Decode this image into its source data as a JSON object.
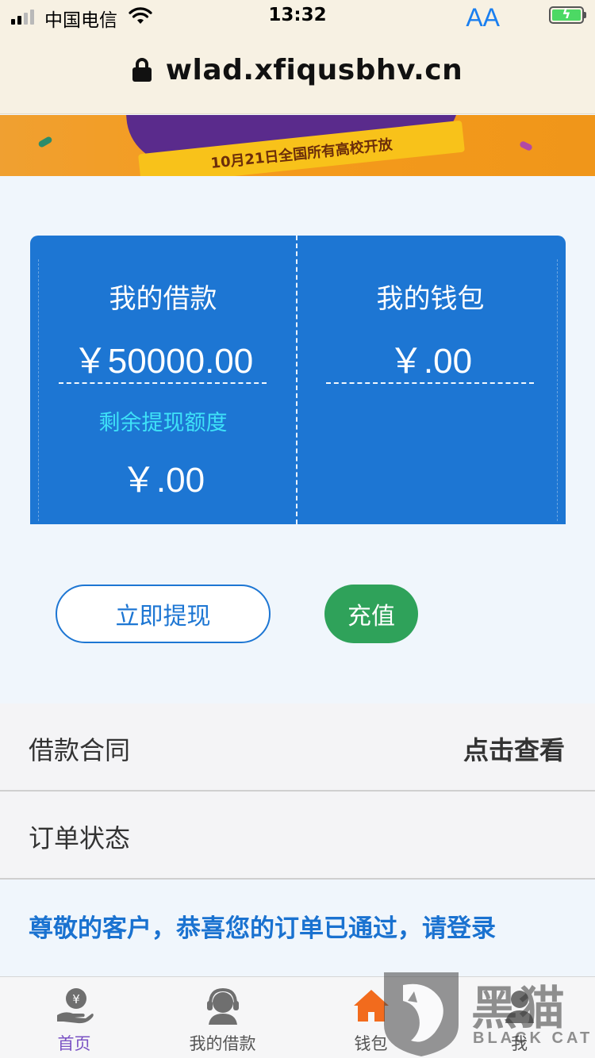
{
  "status_bar": {
    "carrier": "中国电信",
    "time": "13:32"
  },
  "browser": {
    "url": "wlad.xfiqusbhv.cn",
    "text_size_label": "AA"
  },
  "banner": {
    "text": "10月21日全国所有高校开放"
  },
  "card": {
    "loan": {
      "title": "我的借款",
      "amount": "￥50000.00",
      "sub_label": "剩余提现额度",
      "sub_amount": "￥.00"
    },
    "wallet": {
      "title": "我的钱包",
      "amount": "￥.00"
    }
  },
  "actions": {
    "withdraw_label": "立即提现",
    "recharge_label": "充值"
  },
  "list": {
    "contract": {
      "label": "借款合同",
      "action": "点击查看"
    },
    "order_status": {
      "label": "订单状态"
    }
  },
  "notice": "尊敬的客户，恭喜您的订单已通过，请登录",
  "tabs": [
    {
      "label": "首页",
      "icon": "hand-yen-icon",
      "active": true
    },
    {
      "label": "我的借款",
      "icon": "customer-service-icon",
      "active": false
    },
    {
      "label": "钱包",
      "icon": "home-icon",
      "active": false
    },
    {
      "label": "我",
      "icon": "person-icon",
      "active": false
    }
  ],
  "watermark": {
    "brand": "黑猫",
    "en": "BLACK CAT"
  },
  "colors": {
    "primary": "#1d76d3",
    "recharge": "#2fa25a",
    "accent_cyan": "#3ee2f8",
    "tab_active": "#7a52c4",
    "tab_home_icon": "#f26b1d"
  }
}
